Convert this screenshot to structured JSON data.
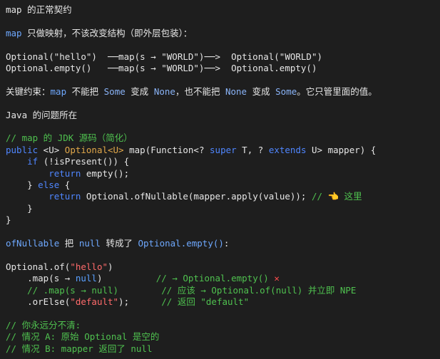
{
  "heading1": "map 的正常契约",
  "intro": {
    "word": "map",
    "text": " 只做映射，不该改变结构（即外层包装）："
  },
  "example": [
    "Optional(\"hello\")  ──map(s → \"WORLD\")──>  Optional(\"WORLD\")",
    "Optional.empty()   ──map(s → \"WORLD\")──>  Optional.empty()"
  ],
  "key": {
    "a": "关键约束：",
    "map": "map",
    "b": " 不能把 ",
    "some": "Some",
    "c": " 变成 ",
    "none": "None",
    "d": "，也不能把 ",
    "none2": "None",
    "e": " 变成 ",
    "some2": "Some",
    "f": "。它只管里面的值。"
  },
  "heading2": "Java 的问题所在",
  "code1": {
    "comment": "// map 的 JDK 源码（简化）",
    "l2_public": "public",
    "l2_u": " <U> ",
    "l2_type": "Optional<U>",
    "l2_map": " map(Function<? ",
    "l2_super": "super",
    "l2_t": " T, ? ",
    "l2_extends": "extends",
    "l2_end": " U> mapper) {",
    "l3_if": "if",
    "l3_rest": " (!isPresent()) {",
    "l4_return": "return",
    "l4_rest": " empty();",
    "l5_close": "} ",
    "l5_else": "else",
    "l5_brace": " {",
    "l6_return": "return",
    "l6_rest": " Optional.ofNullable(mapper.apply(value)); ",
    "l6_comment": "// ",
    "l6_here": " 这里",
    "l7": "}",
    "l8": "}"
  },
  "ofnull": {
    "a": "ofNullable",
    "b": " 把 ",
    "c": "null",
    "d": " 转成了 ",
    "e": "Optional.empty()",
    "f": ":"
  },
  "code2": {
    "l1a": "Optional.of(",
    "l1b": "\"hello\"",
    "l1c": ")",
    "l2a": "    .map(s → ",
    "l2b": "null",
    "l2c": ")          ",
    "l2d": "// → Optional.empty() ",
    "l2e": "✕",
    "l3": "    // .map(s → null)        // 应该 → Optional.of(null) 并立即 NPE",
    "l4a": "    .orElse(",
    "l4b": "\"default\"",
    "l4c": ");      ",
    "l4d": "// 返回 \"default\""
  },
  "code3": [
    "// 你永远分不清:",
    "// 情况 A: 原始 Optional 是空的",
    "// 情况 B: mapper 返回了 null"
  ],
  "colors": {
    "background": "#1e1e1e",
    "text": "#e6e6e6",
    "keyword": "#4f86ff",
    "type": "#e2a84a",
    "string": "#ff6b6b",
    "comment": "#4fc14f"
  },
  "icons": {
    "hand": "pointing-hand-icon",
    "cross": "cross-mark-icon"
  }
}
